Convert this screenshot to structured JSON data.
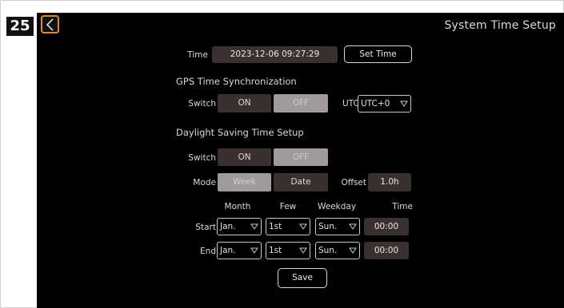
{
  "step_number": "25",
  "page_title": "System Time Setup",
  "time": {
    "label": "Time",
    "value": "2023-12-06 09:27:29",
    "button": "Set Time"
  },
  "gps": {
    "heading": "GPS Time Synchronization",
    "switch_label": "Switch",
    "on": "ON",
    "off": "OFF",
    "utc_label": "UTC",
    "utc_value": "UTC+0"
  },
  "dst": {
    "heading": "Daylight Saving Time Setup",
    "switch_label": "Switch",
    "on": "ON",
    "off": "OFF",
    "mode_label": "Mode",
    "mode_week": "Week",
    "mode_date": "Date",
    "offset_label": "Offset",
    "offset_value": "1.0h",
    "columns": {
      "month": "Month",
      "few": "Few",
      "weekday": "Weekday",
      "time": "Time"
    },
    "start": {
      "label": "Start",
      "month": "Jan.",
      "few": "1st",
      "weekday": "Sun.",
      "time": "00:00"
    },
    "end": {
      "label": "End",
      "month": "Jan.",
      "few": "1st",
      "weekday": "Sun.",
      "time": "00:00"
    }
  },
  "save_label": "Save",
  "icons": {
    "back": "chevron-left-icon",
    "dropdown": "triangle-down-icon"
  },
  "colors": {
    "screen_bg": "#000000",
    "field_bg": "#3a302f",
    "off_bg": "#a09a9a",
    "back_border": "#e08a2c"
  }
}
